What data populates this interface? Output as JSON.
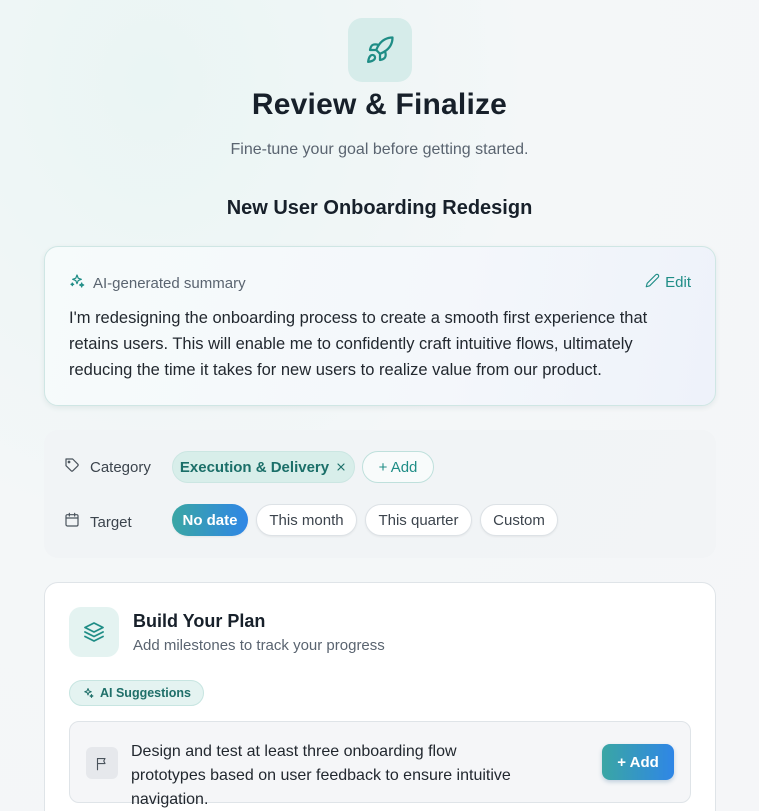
{
  "header": {
    "icon": "rocket-icon",
    "title": "Review & Finalize",
    "subtitle": "Fine-tune your goal before getting started."
  },
  "goal": {
    "name": "New User Onboarding Redesign"
  },
  "summary": {
    "label": "AI-generated summary",
    "label_icon": "sparkles-icon",
    "edit_label": "Edit",
    "edit_icon": "pencil-icon",
    "text": "I'm redesigning the onboarding process to create a smooth first experience that retains users. This will enable me to confidently craft intuitive flows, ultimately reducing the time it takes for new users to realize value from our product."
  },
  "meta": {
    "category": {
      "label": "Category",
      "icon": "tag-icon",
      "selected": "Execution & Delivery",
      "remove_icon": "close-icon",
      "add_label": "+ Add"
    },
    "target": {
      "label": "Target",
      "icon": "calendar-icon",
      "options": [
        "No date",
        "This month",
        "This quarter",
        "Custom"
      ],
      "selected": "No date"
    }
  },
  "plan": {
    "icon": "layers-icon",
    "title": "Build Your Plan",
    "subtitle": "Add milestones to track your progress",
    "ai_badge": "AI Suggestions",
    "suggestions": [
      {
        "icon": "flag-icon",
        "text": "Design and test at least three onboarding flow prototypes based on user feedback to ensure intuitive navigation.",
        "add_label": "+ Add"
      }
    ]
  },
  "colors": {
    "accent": "#1f8d86",
    "gradient_start": "#3aa6a4",
    "gradient_end": "#2f86e6"
  }
}
